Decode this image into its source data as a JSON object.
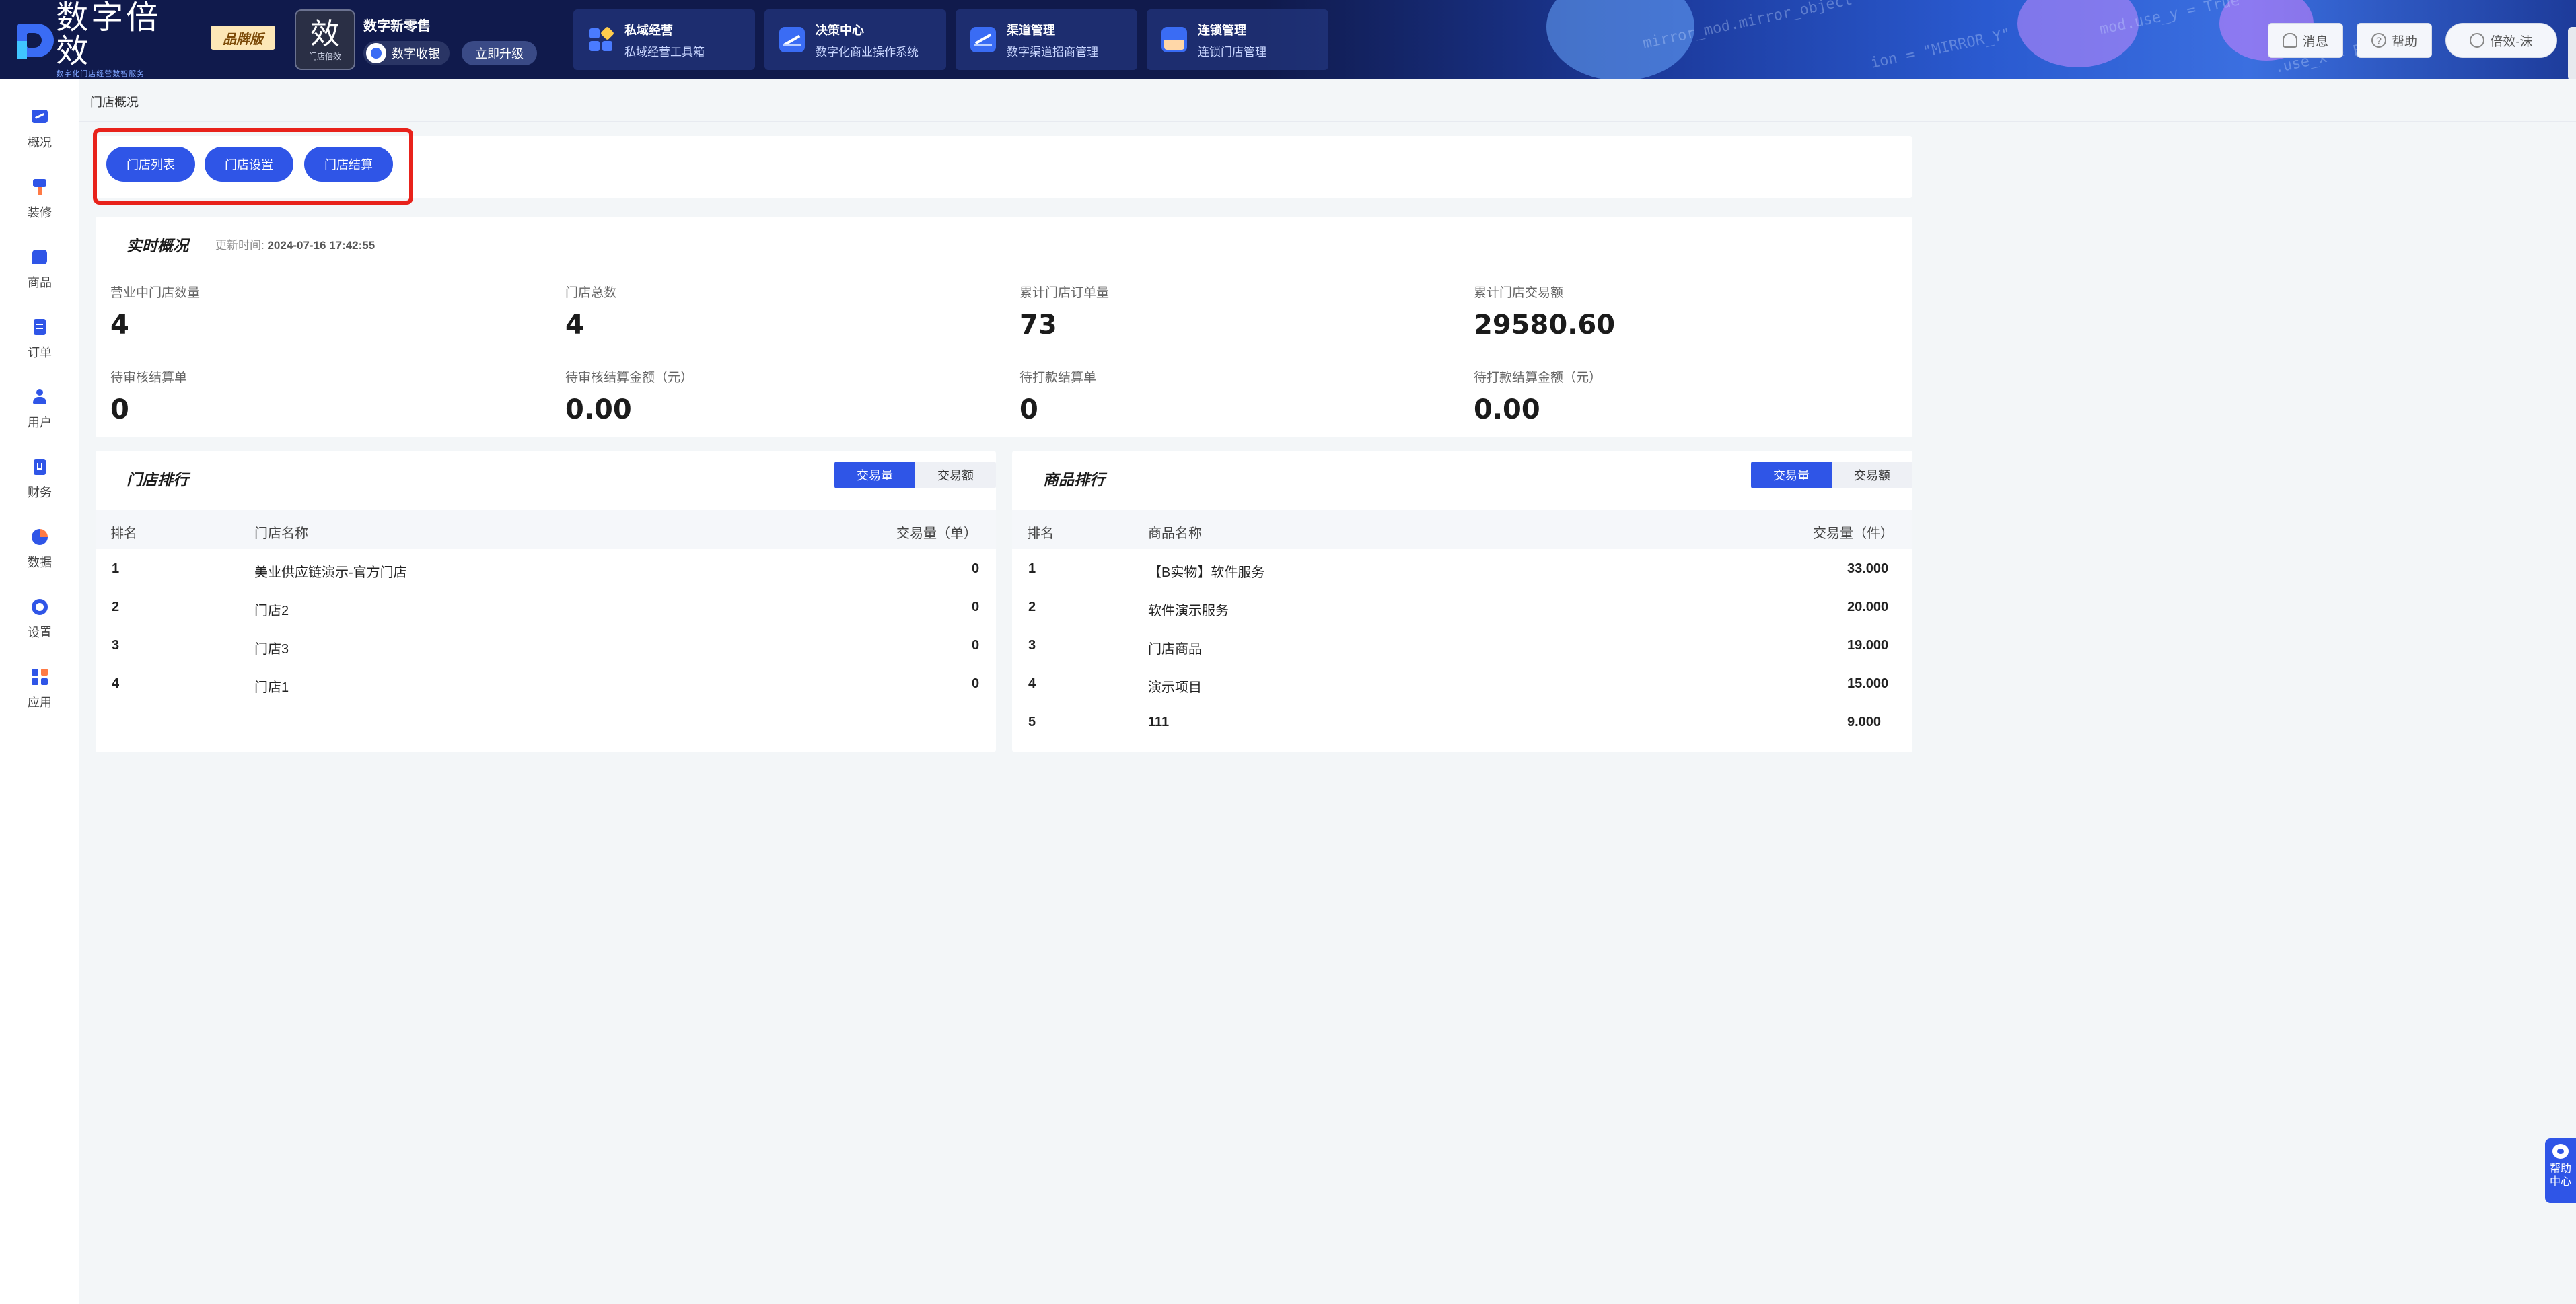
{
  "header": {
    "logo_text": "数字倍效",
    "logo_tagline": "数字化门店经营数智服务",
    "brand_badge": "品牌版",
    "store_logo_char": "效",
    "store_logo_sub": "门店倍效",
    "store_name": "数字新零售",
    "system_label": "数字收银",
    "upgrade_label": "立即升级",
    "nav": [
      {
        "title": "私域经营",
        "subtitle": "私域经营工具箱"
      },
      {
        "title": "决策中心",
        "subtitle": "数字化商业操作系统"
      },
      {
        "title": "渠道管理",
        "subtitle": "数字渠道招商管理"
      },
      {
        "title": "连锁管理",
        "subtitle": "连锁门店管理"
      }
    ],
    "message_label": "消息",
    "help_label": "帮助",
    "user_label": "倍效-沫"
  },
  "sidebar": {
    "items": [
      {
        "label": "概况",
        "icon": "overview-icon"
      },
      {
        "label": "装修",
        "icon": "decorate-icon"
      },
      {
        "label": "商品",
        "icon": "goods-icon"
      },
      {
        "label": "订单",
        "icon": "order-icon"
      },
      {
        "label": "用户",
        "icon": "user-icon"
      },
      {
        "label": "财务",
        "icon": "finance-icon"
      },
      {
        "label": "数据",
        "icon": "data-icon"
      },
      {
        "label": "设置",
        "icon": "settings-icon"
      },
      {
        "label": "应用",
        "icon": "apps-icon"
      }
    ]
  },
  "breadcrumb": "门店概况",
  "quick_buttons": [
    "门店列表",
    "门店设置",
    "门店结算"
  ],
  "realtime": {
    "title": "实时概况",
    "update_label": "更新时间:",
    "update_time": "2024-07-16 17:42:55",
    "metrics": [
      {
        "label": "营业中门店数量",
        "value": "4"
      },
      {
        "label": "门店总数",
        "value": "4"
      },
      {
        "label": "累计门店订单量",
        "value": "73"
      },
      {
        "label": "累计门店交易额",
        "value": "29580.60"
      },
      {
        "label": "待审核结算单",
        "value": "0"
      },
      {
        "label": "待审核结算金额（元）",
        "value": "0.00"
      },
      {
        "label": "待打款结算单",
        "value": "0"
      },
      {
        "label": "待打款结算金额（元）",
        "value": "0.00"
      }
    ]
  },
  "store_rank": {
    "title": "门店排行",
    "tab_active": "交易量",
    "tab_inactive": "交易额",
    "columns": [
      "排名",
      "门店名称",
      "交易量（单）"
    ],
    "rows": [
      {
        "rank": "1",
        "name": "美业供应链演示-官方门店",
        "value": "0"
      },
      {
        "rank": "2",
        "name": "门店2",
        "value": "0"
      },
      {
        "rank": "3",
        "name": "门店3",
        "value": "0"
      },
      {
        "rank": "4",
        "name": "门店1",
        "value": "0"
      }
    ]
  },
  "goods_rank": {
    "title": "商品排行",
    "tab_active": "交易量",
    "tab_inactive": "交易额",
    "columns": [
      "排名",
      "商品名称",
      "交易量（件）"
    ],
    "rows": [
      {
        "rank": "1",
        "name": "【B实物】软件服务",
        "value": "33.000"
      },
      {
        "rank": "2",
        "name": "软件演示服务",
        "value": "20.000"
      },
      {
        "rank": "3",
        "name": "门店商品",
        "value": "19.000"
      },
      {
        "rank": "4",
        "name": "演示项目",
        "value": "15.000"
      },
      {
        "rank": "5",
        "name": "111",
        "value": "9.000"
      }
    ]
  },
  "help_float": [
    "帮助",
    "中心"
  ],
  "colors": {
    "primary": "#2f55e7",
    "header": "#101a4c",
    "highlight": "#e8221b"
  }
}
